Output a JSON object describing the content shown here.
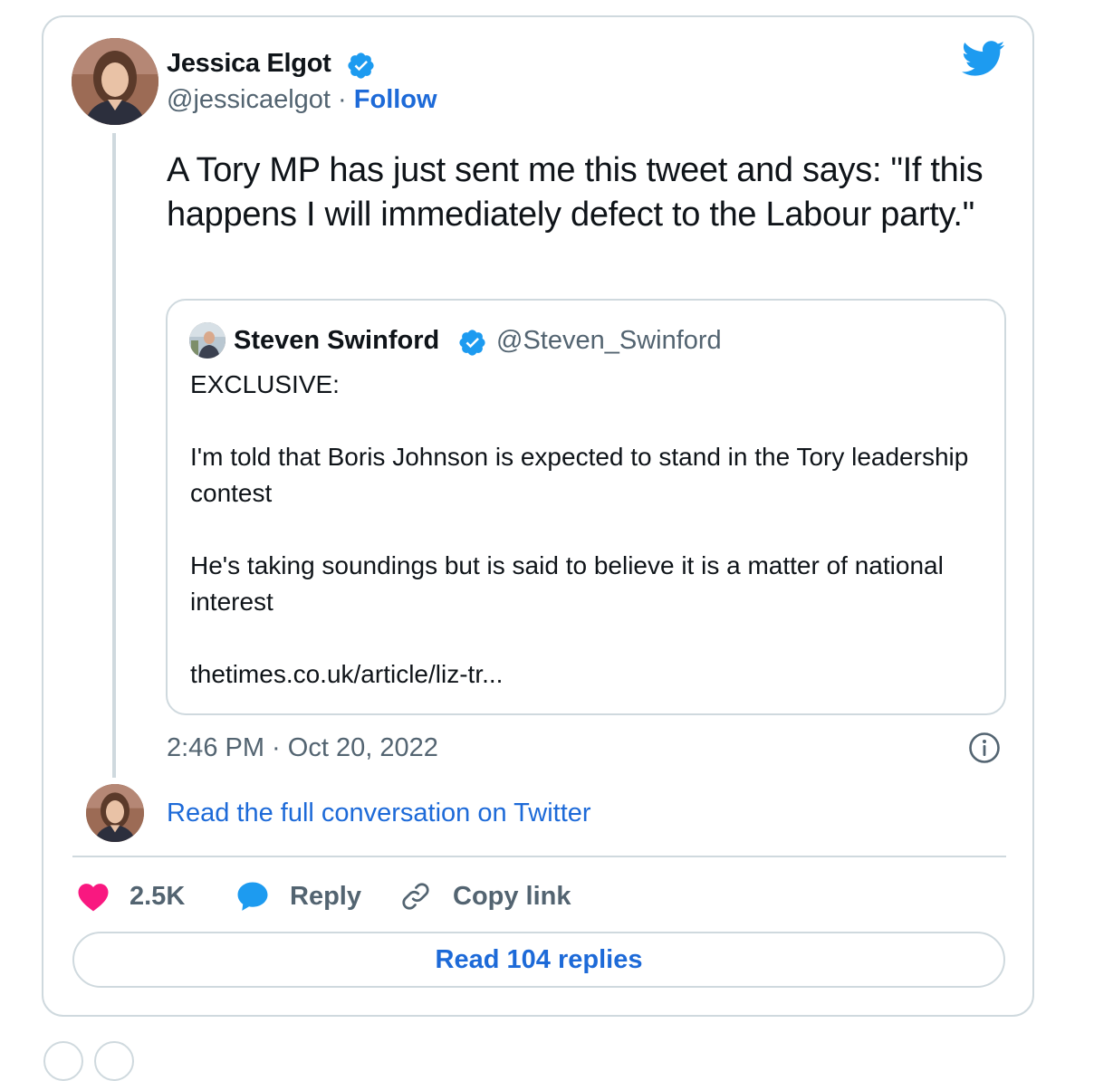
{
  "tweet": {
    "author_name": "Jessica Elgot",
    "author_handle": "@jessicaelgot",
    "separator": "·",
    "follow_label": "Follow",
    "text": "A Tory MP has just sent me this tweet and says: \"If this happens I will immediately defect to the Labour party.\"",
    "timestamp": "2:46 PM · Oct 20, 2022"
  },
  "quoted_tweet": {
    "author_name": "Steven Swinford",
    "author_handle": "@Steven_Swinford",
    "text": "EXCLUSIVE:\n\nI'm told that Boris Johnson is expected to stand in the Tory leadership contest\n\nHe's taking soundings but is said to believe it is a matter of national interest\n\nthetimes.co.uk/article/liz-tr..."
  },
  "conversation_link": "Read the full conversation on Twitter",
  "actions": {
    "like_count": "2.5K",
    "reply_label": "Reply",
    "copy_link_label": "Copy link"
  },
  "read_replies_label": "Read 104 replies",
  "colors": {
    "brand_blue": "#1d9bf0",
    "link_blue": "#1d6ad8",
    "like_pink": "#f91880",
    "muted_text": "#536471",
    "border": "#cfd9de"
  },
  "icons": [
    "verified-badge-icon",
    "twitter-bird-icon",
    "info-icon",
    "heart-icon",
    "reply-bubble-icon",
    "link-icon"
  ]
}
